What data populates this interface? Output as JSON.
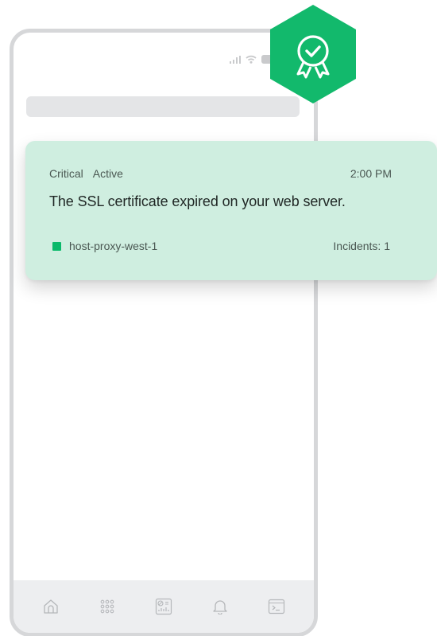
{
  "status_bar": {
    "icons": [
      "signal-icon",
      "wifi-icon",
      "battery-icon"
    ]
  },
  "badge": {
    "icon": "certificate-icon",
    "color": "#12b96c"
  },
  "notification": {
    "severity": "Critical",
    "state": "Active",
    "time": "2:00 PM",
    "message": "The SSL certificate expired on your web server.",
    "host": "host-proxy-west-1",
    "host_color": "#0ab96a",
    "incidents_label": "Incidents: 1",
    "background": "#cfeee0"
  },
  "bottom_nav": {
    "items": [
      {
        "icon": "home-icon"
      },
      {
        "icon": "apps-grid-icon"
      },
      {
        "icon": "dashboard-icon"
      },
      {
        "icon": "bell-icon"
      },
      {
        "icon": "terminal-icon"
      }
    ]
  }
}
